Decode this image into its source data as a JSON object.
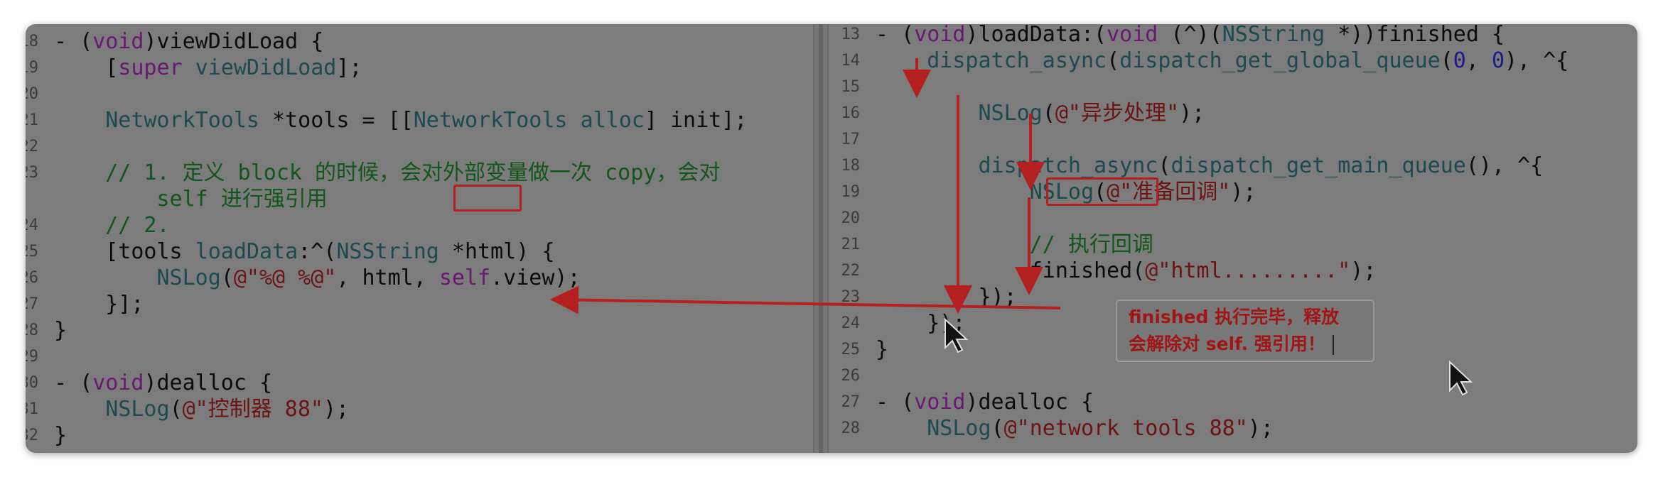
{
  "left_pane": {
    "lines": [
      {
        "n": "18",
        "html": "- (<span class='kw'>void</span>)viewDidLoad {"
      },
      {
        "n": "19",
        "html": "    [<span class='kw'>super</span> <span class='cls'>viewDidLoad</span>];"
      },
      {
        "n": "20",
        "html": ""
      },
      {
        "n": "21",
        "html": "    <span class='cls'>NetworkTools</span> *tools = [[<span class='cls'>NetworkTools</span> <span class='cls'>alloc</span>] init];"
      },
      {
        "n": "22",
        "html": ""
      },
      {
        "n": "23",
        "html": "    <span class='cmt'>// 1. 定义 block 的时候，会对外部变量做一次 copy，会对</span>"
      },
      {
        "n": "",
        "html": "        <span class='cmt'>self 进行强引用</span>"
      },
      {
        "n": "24",
        "html": "    <span class='cmt'>// 2.</span>"
      },
      {
        "n": "25",
        "html": "    [tools <span class='cls'>loadData</span>:^(<span class='cls'>NSString</span> *html) {"
      },
      {
        "n": "26",
        "html": "        <span class='cls'>NSLog</span>(<span class='str'>@\"%@ %@\"</span>, html, <span class='kw'>self</span>.view);"
      },
      {
        "n": "27",
        "html": "    }];"
      },
      {
        "n": "28",
        "html": "}"
      },
      {
        "n": "29",
        "html": ""
      },
      {
        "n": "30",
        "html": "- (<span class='kw'>void</span>)dealloc {"
      },
      {
        "n": "31",
        "html": "    <span class='cls'>NSLog</span>(<span class='str'>@\"控制器 88\"</span>);"
      },
      {
        "n": "32",
        "html": "}"
      }
    ]
  },
  "right_pane": {
    "lines": [
      {
        "n": "13",
        "html": "- (<span class='kw'>void</span>)loadData:(<span class='kw'>void</span> (^)(<span class='cls'>NSString</span> *))finished {"
      },
      {
        "n": "14",
        "html": "    <span class='cls'>dispatch_async</span>(<span class='cls'>dispatch_get_global_queue</span>(<span class='num'>0</span>, <span class='num'>0</span>), ^{"
      },
      {
        "n": "15",
        "html": ""
      },
      {
        "n": "16",
        "html": "        <span class='cls'>NSLog</span>(<span class='str'>@\"异步处理\"</span>);"
      },
      {
        "n": "17",
        "html": ""
      },
      {
        "n": "18",
        "html": "        <span class='cls'>dispatch_async</span>(<span class='cls'>dispatch_get_main_queue</span>(), ^{"
      },
      {
        "n": "19",
        "html": "            <span class='cls'>NSLog</span>(<span class='str'>@\"准备回调\"</span>);"
      },
      {
        "n": "20",
        "html": ""
      },
      {
        "n": "21",
        "html": "            <span class='cmt'>// 执行回调</span>"
      },
      {
        "n": "22",
        "html": "            finished(<span class='str'>@\"html.........\"</span>);"
      },
      {
        "n": "23",
        "html": "        });"
      },
      {
        "n": "24",
        "html": "    });"
      },
      {
        "n": "25",
        "html": "}"
      },
      {
        "n": "26",
        "html": ""
      },
      {
        "n": "27",
        "html": "- (<span class='kw'>void</span>)dealloc {"
      },
      {
        "n": "28",
        "html": "    <span class='cls'>NSLog</span>(<span class='str'>@\"network tools 88\"</span>);"
      }
    ]
  },
  "annotation": {
    "line1": "finished 执行完毕，释放",
    "line2": "会解除对 self. 强引用！"
  },
  "colors": {
    "annotation_red": "#b41f1f",
    "editor_background": "#7c7c7c"
  },
  "icons": [
    "arrow-cursor-icon"
  ]
}
